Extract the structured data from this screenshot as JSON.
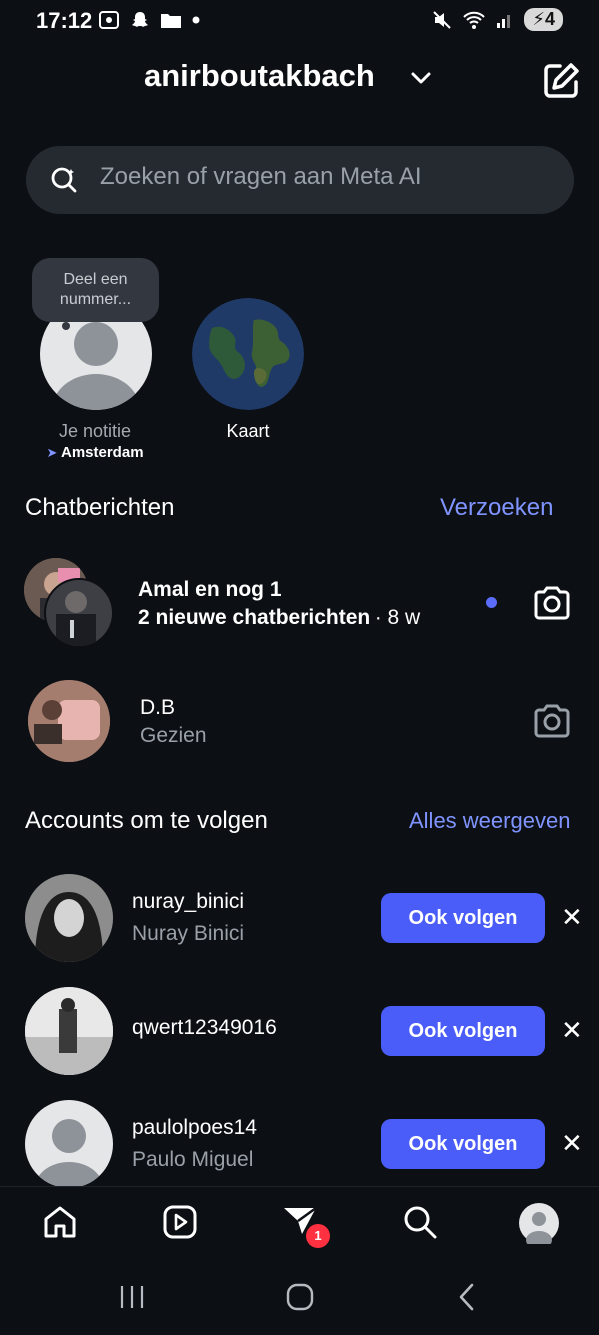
{
  "status_bar": {
    "time": "17:12",
    "battery": "4"
  },
  "header": {
    "username": "anirboutakbach"
  },
  "search": {
    "placeholder": "Zoeken of vragen aan Meta AI"
  },
  "notes": {
    "own": {
      "bubble": "Deel een nummer...",
      "label": "Je notitie",
      "location": "Amsterdam"
    },
    "map": {
      "label": "Kaart"
    }
  },
  "chats_section": {
    "title": "Chatberichten",
    "requests_link": "Verzoeken"
  },
  "chats": [
    {
      "name": "Amal en nog 1",
      "subtitle": "2 nieuwe chatberichten",
      "time": "· 8 w",
      "unread": true
    },
    {
      "name": "D.B",
      "subtitle": "Gezien",
      "unread": false
    }
  ],
  "suggestions_section": {
    "title": "Accounts om te volgen",
    "see_all_link": "Alles weergeven"
  },
  "suggestions": [
    {
      "username": "nuray_binici",
      "name": "Nuray Binici",
      "button": "Ook volgen"
    },
    {
      "username": "qwert12349016",
      "name": "",
      "button": "Ook volgen"
    },
    {
      "username": "paulolpoes14",
      "name": "Paulo Miguel",
      "button": "Ook volgen"
    }
  ],
  "bottom_nav": {
    "messages_badge": "1"
  },
  "colors": {
    "accent": "#4a5df9",
    "link": "#7f94ff",
    "background": "#0c0f14",
    "badge": "#ff3040"
  }
}
